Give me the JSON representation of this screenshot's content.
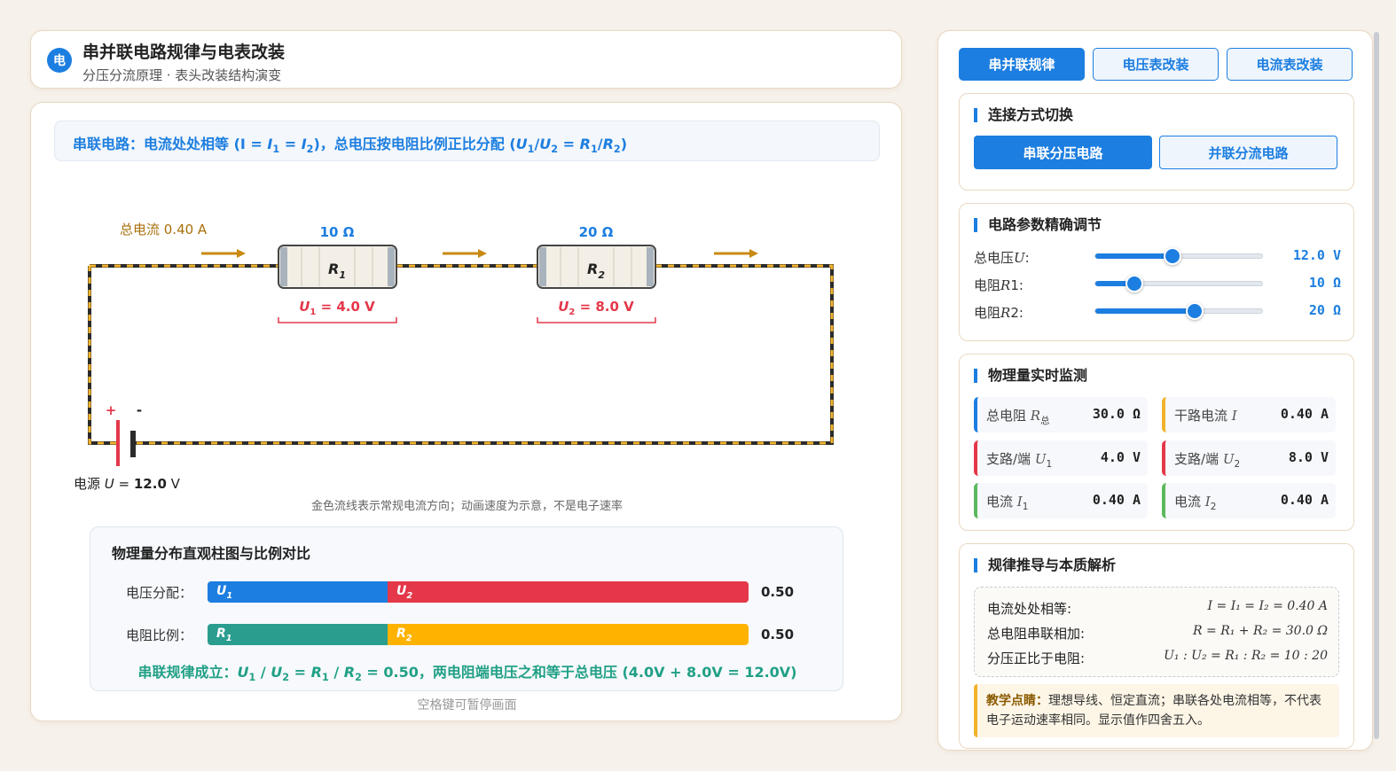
{
  "header": {
    "logo": "电",
    "title": "串并联电路规律与电表改装",
    "subtitle": "分压分流原理 · 表头改装结构演变"
  },
  "formula": {
    "prefix": "串联电路：电流处处相等 (I = ",
    "i": "I",
    "sub1": "1",
    "eq": " = ",
    "sub2": "2",
    "mid": ")，总电压按电阻比例正比分配 (",
    "u": "U",
    "slash": "/",
    "r": "R",
    "end": ")"
  },
  "circuit": {
    "total_current": "总电流 0.40 A",
    "r1_value": "10 Ω",
    "r2_value": "20 Ω",
    "r1_label": "R",
    "r1_sub": "1",
    "r2_label": "R",
    "r2_sub": "2",
    "u1_label": "U",
    "u1_sub": "1",
    "u1_value": " = 4.0 V",
    "u2_label": "U",
    "u2_sub": "2",
    "u2_value": " = 8.0 V",
    "plus": "+",
    "minus": "-",
    "source_prefix": "电源 ",
    "source_u": "U",
    "source_eq": " = ",
    "source_value": "12.0",
    "source_unit": " V",
    "caption": "金色流线表示常规电流方向；动画速度为示意，不是电子速率",
    "colors": {
      "wire": "#2b2b2b",
      "flow": "#f2b32c",
      "arrow": "#c98a12",
      "voltage": "#e4384a",
      "value": "#1c7ee0"
    }
  },
  "chart": {
    "title": "物理量分布直观柱图与比例对比",
    "voltage_label": "电压分配：",
    "resistance_label": "电阻比例：",
    "voltage_ratio": "0.50",
    "resistance_ratio": "0.50",
    "u1_fraction": 0.3333,
    "r1_fraction": 0.3333,
    "seg_u1": "U",
    "seg_u2": "U",
    "seg_r1": "R",
    "seg_r2": "R",
    "sub1": "1",
    "sub2": "2",
    "colors": {
      "u1": "#1c7ee0",
      "u2": "#e4384a",
      "r1": "#2a9d8f",
      "r2": "#ffb300"
    },
    "conclusion_prefix": "串联规律成立：",
    "conclusion_suffix": " = 0.50，两电阻端电压之和等于总电压 (4.0V + 8.0V = 12.0V)"
  },
  "hint": "空格键可暂停画面",
  "tabs": [
    "串并联规律",
    "电压表改装",
    "电流表改装"
  ],
  "connection": {
    "title": "连接方式切换",
    "series_btn": "串联分压电路",
    "parallel_btn": "并联分流电路"
  },
  "params": {
    "title": "电路参数精确调节",
    "items": [
      {
        "label": "总电压",
        "sym": "U",
        "colon": ":",
        "value": "12.0 V",
        "fraction": 0.46
      },
      {
        "label": "电阻",
        "sym": "R",
        "sub": "1",
        "colon": ":",
        "value": "10 Ω",
        "fraction": 0.23
      },
      {
        "label": "电阻",
        "sym": "R",
        "sub": "2",
        "colon": ":",
        "value": "20 Ω",
        "fraction": 0.59
      }
    ]
  },
  "monitor": {
    "title": "物理量实时监测",
    "items": [
      {
        "label": "总电阻 ",
        "sym": "R",
        "sub": "总",
        "value": "30.0 Ω",
        "color": "#1c7ee0"
      },
      {
        "label": "干路电流 ",
        "sym": "I",
        "sub": "",
        "value": "0.40 A",
        "color": "#f2b32c"
      },
      {
        "label": "支路/端 ",
        "sym": "U",
        "sub": "1",
        "value": "4.0 V",
        "color": "#e4384a"
      },
      {
        "label": "支路/端 ",
        "sym": "U",
        "sub": "2",
        "value": "8.0 V",
        "color": "#e4384a"
      },
      {
        "label": "电流 ",
        "sym": "I",
        "sub": "1",
        "value": "0.40 A",
        "color": "#5cb85c"
      },
      {
        "label": "电流 ",
        "sym": "I",
        "sub": "2",
        "value": "0.40 A",
        "color": "#5cb85c"
      }
    ]
  },
  "derivation": {
    "title": "规律推导与本质解析",
    "rows": [
      {
        "label": "电流处处相等:",
        "expr": "I = I₁   = I₂   = 0.40 A"
      },
      {
        "label": "总电阻串联相加:",
        "expr": "R = R₁   + R₂   = 30.0 Ω"
      },
      {
        "label": "分压正比于电阻:",
        "expr": "U₁   : U₂   = R₁   : R₂   = 10 : 20"
      }
    ],
    "note_bold": "教学点睛：",
    "note_text": "理想导线、恒定直流；串联各处电流相等，不代表电子运动速率相同。显示值作四舍五入。"
  }
}
